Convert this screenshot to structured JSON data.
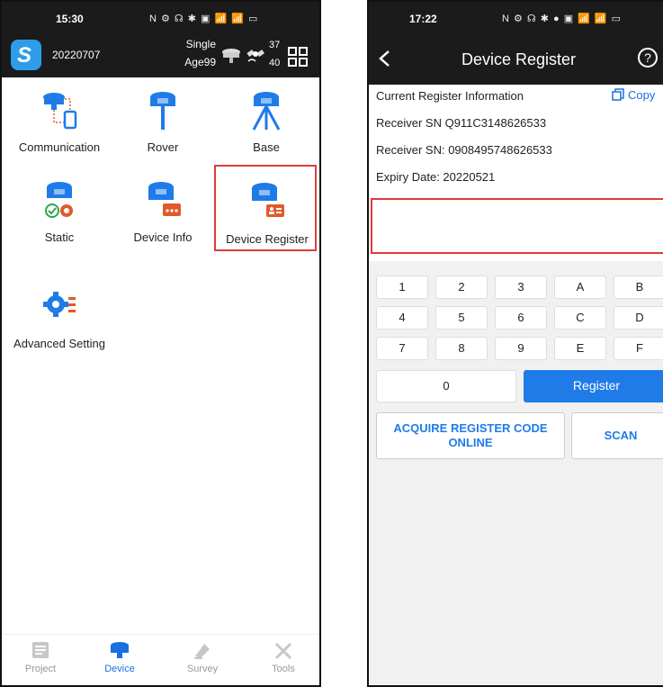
{
  "left": {
    "status_time": "15:30",
    "status_icons": "N ⚙ ☊ ✱ ▣ 📶 📶 ▭",
    "project_name": "20220707",
    "fix_state": "Single",
    "age": "Age99",
    "sat_used": "37",
    "sat_total": "40",
    "tiles": [
      {
        "label": "Communication"
      },
      {
        "label": "Rover"
      },
      {
        "label": "Base"
      },
      {
        "label": "Static"
      },
      {
        "label": "Device Info"
      },
      {
        "label": "Device Register"
      },
      {
        "label": "Advanced Setting"
      }
    ],
    "nav": [
      {
        "label": "Project"
      },
      {
        "label": "Device"
      },
      {
        "label": "Survey"
      },
      {
        "label": "Tools"
      }
    ]
  },
  "right": {
    "status_time": "17:22",
    "status_icons": "N ⚙ ☊ ✱ ● ▣ 📶 📶 ▭",
    "title": "Device Register",
    "info_title": "Current Register Information",
    "copy_label": "Copy",
    "receiver_sn_1": "Receiver SN  Q911C3148626533",
    "receiver_sn_2": "Receiver SN:  0908495748626533",
    "expiry": "Expiry Date:  20220521",
    "keys": [
      "1",
      "2",
      "3",
      "A",
      "B",
      "4",
      "5",
      "6",
      "C",
      "D",
      "7",
      "8",
      "9",
      "E",
      "F"
    ],
    "key_zero": "0",
    "register_label": "Register",
    "acquire_line1": "ACQUIRE REGISTER CODE",
    "acquire_line2": "ONLINE",
    "scan_label": "SCAN"
  },
  "colors": {
    "accent": "#1f7be8",
    "highlight": "#e03b3b",
    "header_bg": "#1b1b1b"
  }
}
